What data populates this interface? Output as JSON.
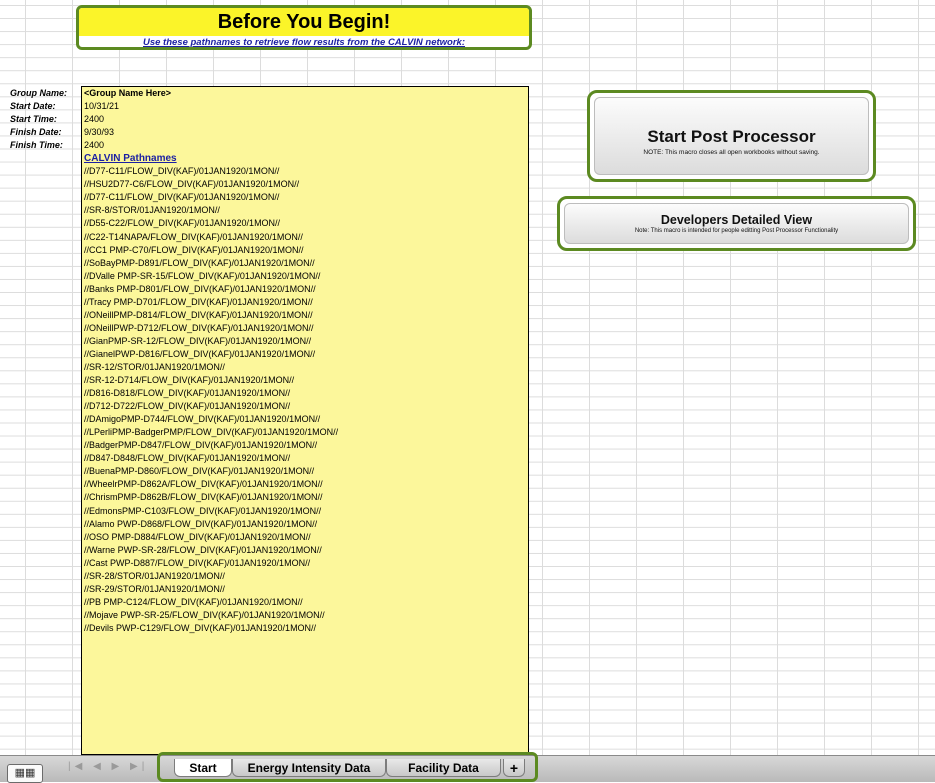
{
  "banner": {
    "title": "Before You Begin!",
    "subtitle": "Use these pathnames to retrieve flow results from the CALVIN network:"
  },
  "labels": [
    "Group Name:",
    "Start Date:",
    "Start Time:",
    "Finish Date:",
    "Finish Time:"
  ],
  "values": {
    "group_name": "<Group Name Here>",
    "start_date": "10/31/21",
    "start_time": "2400",
    "finish_date": "9/30/93",
    "finish_time": "2400"
  },
  "pathnames_header": "CALVIN Pathnames",
  "pathnames": [
    "//D77-C11/FLOW_DIV(KAF)/01JAN1920/1MON//",
    "//HSU2D77-C6/FLOW_DIV(KAF)/01JAN1920/1MON//",
    "//D77-C11/FLOW_DIV(KAF)/01JAN1920/1MON//",
    "//SR-8/STOR/01JAN1920/1MON//",
    "//D55-C22/FLOW_DIV(KAF)/01JAN1920/1MON//",
    "//C22-T14NAPA/FLOW_DIV(KAF)/01JAN1920/1MON//",
    "//CC1 PMP-C70/FLOW_DIV(KAF)/01JAN1920/1MON//",
    "//SoBayPMP-D891/FLOW_DIV(KAF)/01JAN1920/1MON//",
    "//DValle PMP-SR-15/FLOW_DIV(KAF)/01JAN1920/1MON//",
    "//Banks PMP-D801/FLOW_DIV(KAF)/01JAN1920/1MON//",
    "//Tracy PMP-D701/FLOW_DIV(KAF)/01JAN1920/1MON//",
    "//ONeillPMP-D814/FLOW_DIV(KAF)/01JAN1920/1MON//",
    "//ONeillPWP-D712/FLOW_DIV(KAF)/01JAN1920/1MON//",
    "//GianPMP-SR-12/FLOW_DIV(KAF)/01JAN1920/1MON//",
    "//GianelPWP-D816/FLOW_DIV(KAF)/01JAN1920/1MON//",
    "//SR-12/STOR/01JAN1920/1MON//",
    "//SR-12-D714/FLOW_DIV(KAF)/01JAN1920/1MON//",
    "//D816-D818/FLOW_DIV(KAF)/01JAN1920/1MON//",
    "//D712-D722/FLOW_DIV(KAF)/01JAN1920/1MON//",
    "//DAmigoPMP-D744/FLOW_DIV(KAF)/01JAN1920/1MON//",
    "//LPerliPMP-BadgerPMP/FLOW_DIV(KAF)/01JAN1920/1MON//",
    "//BadgerPMP-D847/FLOW_DIV(KAF)/01JAN1920/1MON//",
    "//D847-D848/FLOW_DIV(KAF)/01JAN1920/1MON//",
    "//BuenaPMP-D860/FLOW_DIV(KAF)/01JAN1920/1MON//",
    "//WheelrPMP-D862A/FLOW_DIV(KAF)/01JAN1920/1MON//",
    "//ChrismPMP-D862B/FLOW_DIV(KAF)/01JAN1920/1MON//",
    "//EdmonsPMP-C103/FLOW_DIV(KAF)/01JAN1920/1MON//",
    "//Alamo PWP-D868/FLOW_DIV(KAF)/01JAN1920/1MON//",
    "//OSO PMP-D884/FLOW_DIV(KAF)/01JAN1920/1MON//",
    "//Warne PWP-SR-28/FLOW_DIV(KAF)/01JAN1920/1MON//",
    "//Cast PWP-D887/FLOW_DIV(KAF)/01JAN1920/1MON//",
    "//SR-28/STOR/01JAN1920/1MON//",
    "//SR-29/STOR/01JAN1920/1MON//",
    "//PB PMP-C124/FLOW_DIV(KAF)/01JAN1920/1MON//",
    "//Mojave PWP-SR-25/FLOW_DIV(KAF)/01JAN1920/1MON//",
    "//Devils PWP-C129/FLOW_DIV(KAF)/01JAN1920/1MON//"
  ],
  "buttons": {
    "start": {
      "title": "Start Post Processor",
      "note": "NOTE: This macro closes all open workbooks without saving."
    },
    "dev": {
      "title": "Developers Detailed View",
      "note": "Note: This macro is intended for people editting Post Processor Functionality"
    }
  },
  "tabs": {
    "sheet1": "Start",
    "sheet2": "Energy Intensity Data",
    "sheet3": "Facility Data",
    "add": "+"
  },
  "nav": {
    "arrows": "|◀ ◀ ▶ ▶|"
  },
  "colors": {
    "accent_green": "#5c8a21",
    "panel_yellow": "#fcf79b",
    "banner_yellow": "#fbf429",
    "link_blue": "#1b1fa3"
  }
}
